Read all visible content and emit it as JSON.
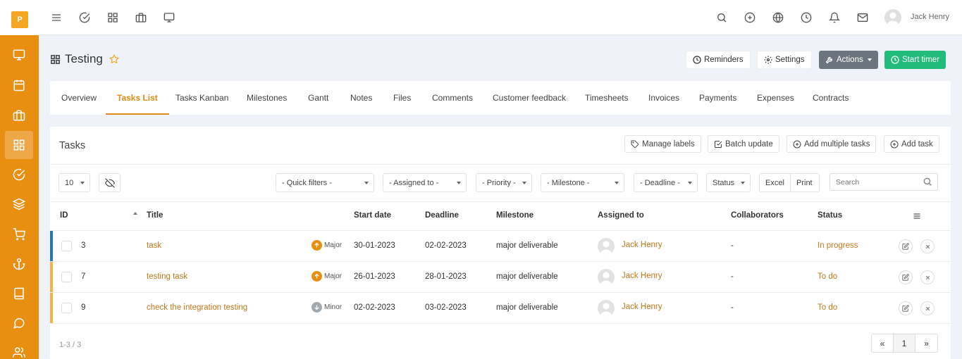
{
  "brand": {
    "logo_letter": "P",
    "accent": "#e88f12"
  },
  "sidebar": {
    "items": [
      {
        "icon": "monitor-icon"
      },
      {
        "icon": "calendar-icon"
      },
      {
        "icon": "briefcase-icon"
      },
      {
        "icon": "grid-icon",
        "active": true
      },
      {
        "icon": "check-circle-icon"
      },
      {
        "icon": "layers-icon"
      },
      {
        "icon": "cart-icon"
      },
      {
        "icon": "anchor-icon"
      },
      {
        "icon": "book-icon"
      },
      {
        "icon": "chat-icon"
      },
      {
        "icon": "users-icon"
      }
    ]
  },
  "topbar": {
    "left_icons": [
      "menu-icon",
      "check-circle-icon",
      "grid-icon",
      "briefcase-icon",
      "monitor-icon"
    ],
    "right_icons": [
      "search-icon",
      "plus-circle-icon",
      "globe-icon",
      "clock-icon",
      "bell-icon",
      "mail-icon"
    ],
    "user_name": "Jack Henry"
  },
  "page": {
    "title": "Testing",
    "buttons": {
      "reminders": "Reminders",
      "settings": "Settings",
      "actions": "Actions",
      "start_timer": "Start timer"
    }
  },
  "tabs": [
    {
      "label": "Overview"
    },
    {
      "label": "Tasks List",
      "active": true
    },
    {
      "label": "Tasks Kanban"
    },
    {
      "label": "Milestones"
    },
    {
      "label": "Gantt"
    },
    {
      "label": "Notes"
    },
    {
      "label": "Files"
    },
    {
      "label": "Comments"
    },
    {
      "label": "Customer feedback"
    },
    {
      "label": "Timesheets"
    },
    {
      "label": "Invoices"
    },
    {
      "label": "Payments"
    },
    {
      "label": "Expenses"
    },
    {
      "label": "Contracts"
    }
  ],
  "tasks_card": {
    "title": "Tasks",
    "buttons": {
      "manage_labels": "Manage labels",
      "batch_update": "Batch update",
      "add_multiple": "Add multiple tasks",
      "add_task": "Add task"
    },
    "filters": {
      "page_size": "10",
      "quick_filters": "- Quick filters -",
      "assigned_to": "- Assigned to -",
      "priority": "- Priority -",
      "milestone": "- Milestone -",
      "deadline": "- Deadline -",
      "status": "Status",
      "excel": "Excel",
      "print": "Print",
      "search_placeholder": "Search"
    },
    "columns": {
      "id": "ID",
      "title": "Title",
      "start_date": "Start date",
      "deadline": "Deadline",
      "milestone": "Milestone",
      "assigned_to": "Assigned to",
      "collaborators": "Collaborators",
      "status": "Status"
    },
    "rows": [
      {
        "id": "3",
        "title": "task",
        "priority": "Major",
        "start_date": "30-01-2023",
        "deadline": "02-02-2023",
        "milestone": "major deliverable",
        "assigned_to": "Jack Henry",
        "collaborators": "-",
        "status": "In progress"
      },
      {
        "id": "7",
        "title": "testing task",
        "priority": "Major",
        "start_date": "26-01-2023",
        "deadline": "28-01-2023",
        "milestone": "major deliverable",
        "assigned_to": "Jack Henry",
        "collaborators": "-",
        "status": "To do"
      },
      {
        "id": "9",
        "title": "check the integration testing",
        "priority": "Minor",
        "start_date": "02-02-2023",
        "deadline": "03-02-2023",
        "milestone": "major deliverable",
        "assigned_to": "Jack Henry",
        "collaborators": "-",
        "status": "To do"
      }
    ],
    "footer": {
      "info": "1-3 / 3",
      "prev": "«",
      "page": "1",
      "next": "»"
    }
  },
  "colors": {
    "row_in_progress": "#1f7ac0",
    "row_todo": "#f2b544",
    "priority_major": "#e88f12",
    "priority_minor": "#a0a8b0",
    "green": "#21bc7b"
  }
}
